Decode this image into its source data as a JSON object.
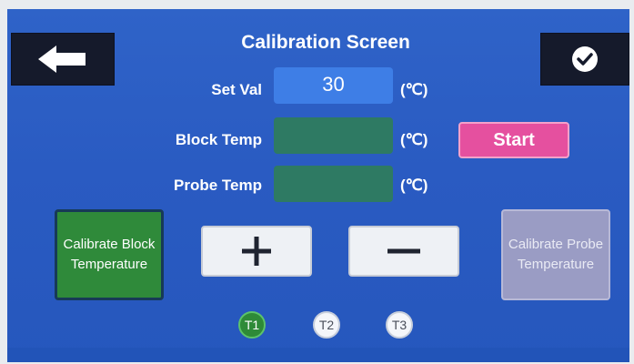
{
  "title": "Calibration Screen",
  "set_val": {
    "label": "Set Val",
    "value": "30",
    "unit": "(℃)"
  },
  "block_temp": {
    "label": "Block Temp",
    "value": "",
    "unit": "(℃)"
  },
  "probe_temp": {
    "label": "Probe Temp",
    "value": "",
    "unit": "(℃)"
  },
  "buttons": {
    "start": "Start",
    "calibrate_block": "Calibrate Block Temperature",
    "calibrate_probe": "Calibrate Probe Temperature",
    "back_icon": "arrow-left-icon",
    "confirm_icon": "checkmark-icon",
    "plus_icon": "plus-icon",
    "minus_icon": "minus-icon"
  },
  "tabs": [
    {
      "label": "T1",
      "active": true
    },
    {
      "label": "T2",
      "active": false
    },
    {
      "label": "T3",
      "active": false
    }
  ],
  "colors": {
    "background": "#2a5bc2",
    "start": "#e5509f",
    "green_field": "#2e7a63",
    "calibrate_block": "#2f8a3a",
    "calibrate_probe": "#9a9cc4"
  }
}
